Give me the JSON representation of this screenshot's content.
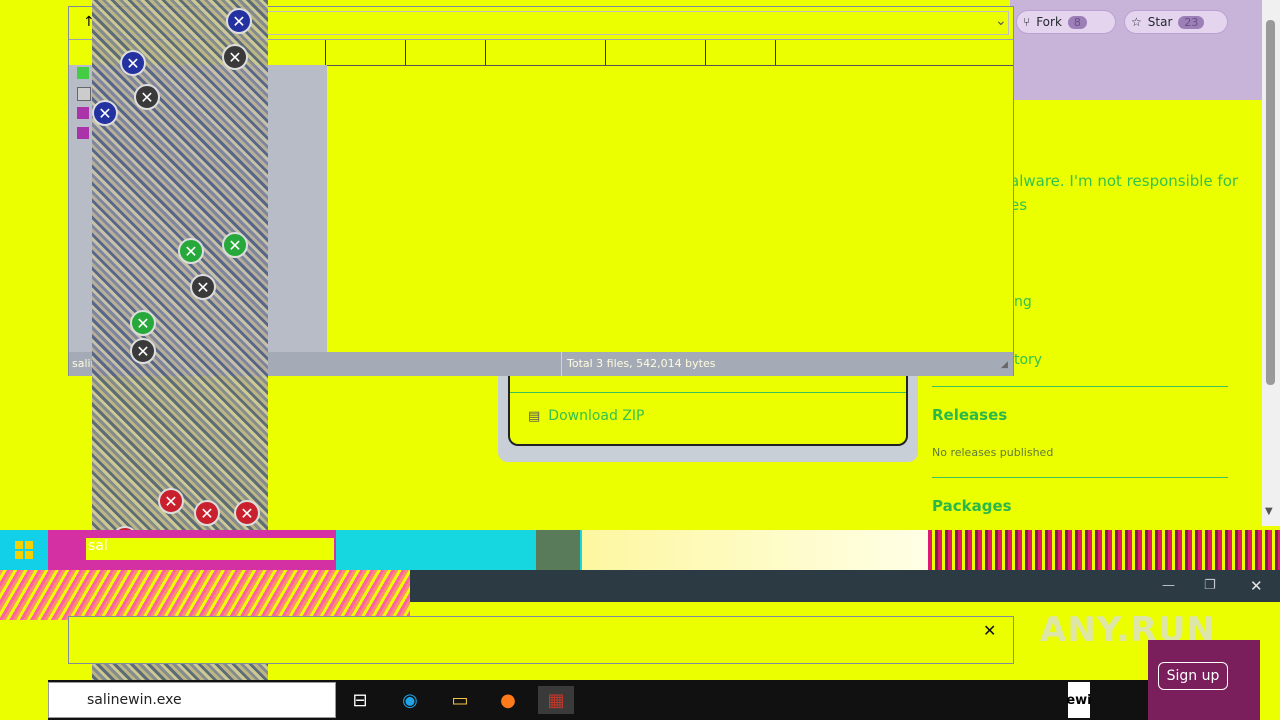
{
  "github": {
    "fork_label": "Fork",
    "fork_count": "8",
    "star_label": "Star",
    "star_count": "23",
    "about_text_1": "alware. I'm not responsible for",
    "about_text_2": "es",
    "partial_1": "ng",
    "partial_2": "tory",
    "releases_heading": "Releases",
    "releases_text": "No releases published",
    "packages_heading": "Packages",
    "download_zip": "Download ZIP"
  },
  "winrar": {
    "up_arrow": "↑",
    "dropdown": "⌄",
    "status_left": "salinew",
    "status_total": "Total 3 files, 542,014 bytes"
  },
  "taskbar_top": {
    "search_text": "sal"
  },
  "window2": {
    "minimize": "—",
    "restore": "❐",
    "close": "✕"
  },
  "dialog": {
    "close": "✕"
  },
  "watermark": {
    "text": "ANY.RUN"
  },
  "signup": {
    "label": "Sign up"
  },
  "taskbar": {
    "search_value": "salinewin.exe",
    "partial_window": "ewi"
  },
  "colors": {
    "background": "#ecff00",
    "accent_green": "#33c24d",
    "anyrun_purple": "#7a1f5c"
  }
}
